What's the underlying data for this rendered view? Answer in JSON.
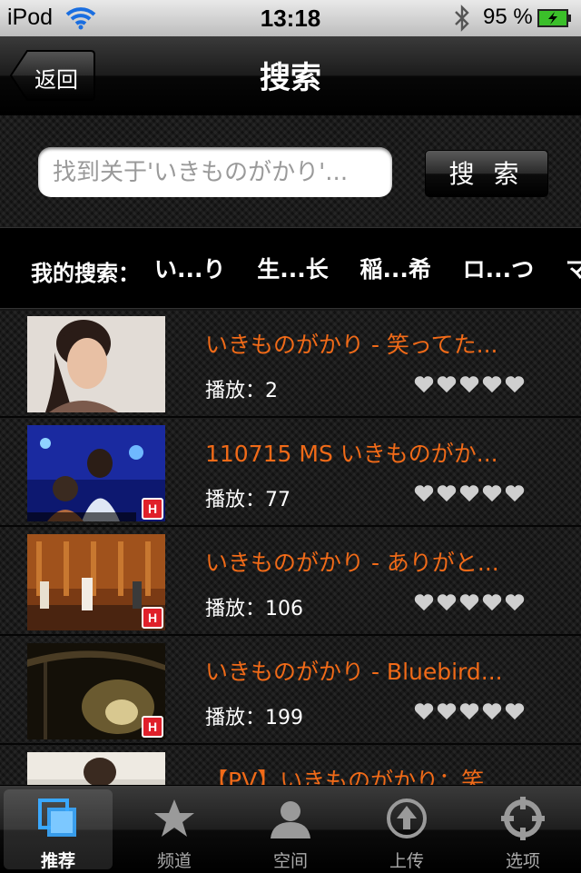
{
  "status_bar": {
    "carrier": "iPod",
    "time": "13:18",
    "battery": "95 %"
  },
  "nav": {
    "back_label": "返回",
    "title": "搜索"
  },
  "search": {
    "placeholder": "找到关于'いきものがかり'...",
    "button_label": "搜 索"
  },
  "history": {
    "label": "我的搜索：",
    "items": [
      "い...り",
      "生...长",
      "稲...希",
      "ロ...つ",
      "マ..."
    ]
  },
  "videos": [
    {
      "title": "いきものがかり - 笑ってた...",
      "plays": "播放：2",
      "hd": false,
      "rating": 5
    },
    {
      "title": "110715 MS いきものがか...",
      "plays": "播放：77",
      "hd": true,
      "hd_label": "H",
      "rating": 5
    },
    {
      "title": "いきものがかり - ありがと...",
      "plays": "播放：106",
      "hd": true,
      "hd_label": "H",
      "rating": 5
    },
    {
      "title": "いきものがかり - Bluebird...",
      "plays": "播放：199",
      "hd": true,
      "hd_label": "H",
      "rating": 5
    },
    {
      "title": "【PV】いきものがかり：笑...",
      "plays": "",
      "hd": false,
      "rating": 0
    }
  ],
  "tabs": [
    {
      "label": "推荐",
      "icon": "recommend-icon",
      "active": true
    },
    {
      "label": "频道",
      "icon": "star-icon",
      "active": false
    },
    {
      "label": "空间",
      "icon": "person-icon",
      "active": false
    },
    {
      "label": "上传",
      "icon": "upload-icon",
      "active": false
    },
    {
      "label": "选项",
      "icon": "crosshair-icon",
      "active": false
    }
  ],
  "colors": {
    "accent_title": "#f06a18",
    "active_tab_icon": "#3aa8ff",
    "rating_heart": "#cfcfcf"
  }
}
